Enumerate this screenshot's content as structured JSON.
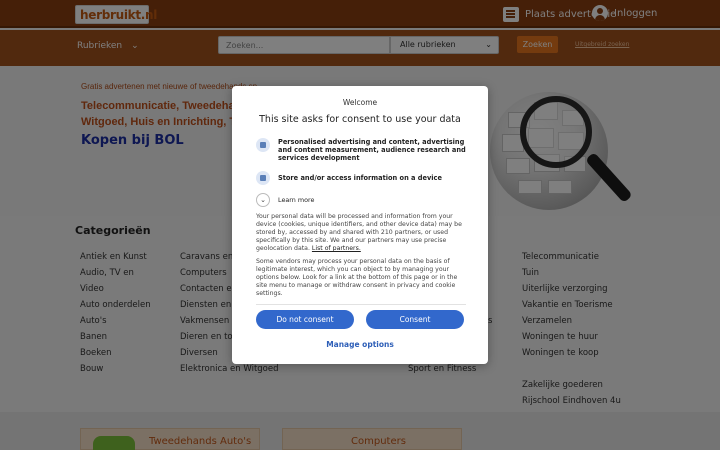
{
  "header": {
    "logo_text": "herbruikt.nl",
    "post_ad_label": "Plaats advertentie",
    "login_label": "Inloggen"
  },
  "nav": {
    "rubrieken_label": "Rubrieken",
    "search_placeholder": "Zoeken...",
    "category_select_value": "Alle rubrieken",
    "search_button_label": "Zoeken",
    "advanced_link": "Uitgebreid zoeken"
  },
  "hero": {
    "tagline": "Gratis advertenen met nieuwe of tweedehands sp",
    "big_categories_line1": "Telecommunicatie, Tweedehands Auto's,",
    "big_categories_line2": "Witgoed, Huis en Inrichting, Tuin, Kind en",
    "bol_link": "Kopen bij BOL"
  },
  "categories": {
    "title": "Categorieën",
    "col1": [
      "Antiek en Kunst",
      "Audio, TV en",
      "Video",
      "Auto onderdelen",
      "Auto's",
      "Banen",
      "Boeken",
      "Bouw"
    ],
    "col2": [
      "Caravans en",
      "Computers",
      "Contacten en",
      "Diensten en",
      "Vakmensen",
      "Dieren en toe",
      "Diversen",
      "Elektronica en Witgoed"
    ],
    "col3_partial": [
      "s"
    ],
    "col4_partial": [
      "Sport en Fitness"
    ],
    "col5": [
      "Telecommunicatie",
      "Tuin",
      "Uiterlijke verzorging",
      "Vakantie en Toerisme",
      "Verzamelen",
      "Woningen te huur",
      "Woningen te koop",
      "",
      "Zakelijke goederen",
      "Rijschool Eindhoven 4u"
    ]
  },
  "cards": {
    "card1": "Tweedehands Auto's",
    "card2": "Computers"
  },
  "consent": {
    "welcome": "Welcome",
    "title": "This site asks for consent to use your data",
    "purpose1": "Personalised advertising and content, advertising and content measurement, audience research and services development",
    "purpose2": "Store and/or access information on a device",
    "learn_more": "Learn more",
    "para1": "Your personal data will be processed and information from your device (cookies, unique identifiers, and other device data) may be stored by, accessed by and shared with 210 partners, or used specifically by this site. We and our partners may use precise geolocation data.",
    "partners_link": "List of partners.",
    "para2": "Some vendors may process your personal data on the basis of legitimate interest, which you can object to by managing your options below. Look for a link at the bottom of this page or in the site menu to manage or withdraw consent in privacy and cookie settings.",
    "do_not_consent": "Do not consent",
    "consent": "Consent",
    "manage_options": "Manage options"
  },
  "colors": {
    "header_bg": "#8a3f10",
    "nav_bg": "#a3521d",
    "accent_orange": "#e8771f",
    "consent_blue": "#3268cc"
  }
}
